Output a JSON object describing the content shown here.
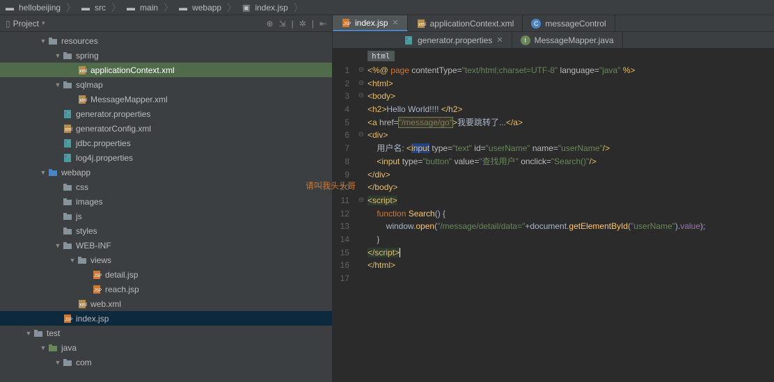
{
  "breadcrumb": [
    {
      "icon": "folder-grey",
      "label": "hellobeijing"
    },
    {
      "icon": "folder-blue",
      "label": "src"
    },
    {
      "icon": "folder-blue",
      "label": "main"
    },
    {
      "icon": "folder-blue",
      "label": "webapp"
    },
    {
      "icon": "jsp",
      "label": "index.jsp"
    }
  ],
  "sidebar": {
    "title": "Project",
    "tree": [
      {
        "indent": 56,
        "arrow": "open",
        "icon": "folder-grey",
        "label": "resources"
      },
      {
        "indent": 77,
        "arrow": "open",
        "icon": "folder-grey",
        "label": "spring"
      },
      {
        "indent": 98,
        "arrow": "none",
        "icon": "xml",
        "label": "applicationContext.xml",
        "hl": "green"
      },
      {
        "indent": 77,
        "arrow": "open",
        "icon": "folder-grey",
        "label": "sqlmap"
      },
      {
        "indent": 98,
        "arrow": "none",
        "icon": "xml",
        "label": "MessageMapper.xml"
      },
      {
        "indent": 77,
        "arrow": "none",
        "icon": "prop",
        "label": "generator.properties"
      },
      {
        "indent": 77,
        "arrow": "none",
        "icon": "xml",
        "label": "generatorConfig.xml"
      },
      {
        "indent": 77,
        "arrow": "none",
        "icon": "prop",
        "label": "jdbc.properties"
      },
      {
        "indent": 77,
        "arrow": "none",
        "icon": "prop",
        "label": "log4j.properties"
      },
      {
        "indent": 56,
        "arrow": "open",
        "icon": "folder-blue",
        "label": "webapp"
      },
      {
        "indent": 77,
        "arrow": "none",
        "icon": "folder-grey",
        "label": "css"
      },
      {
        "indent": 77,
        "arrow": "none",
        "icon": "folder-grey",
        "label": "images"
      },
      {
        "indent": 77,
        "arrow": "none",
        "icon": "folder-grey",
        "label": "js"
      },
      {
        "indent": 77,
        "arrow": "none",
        "icon": "folder-grey",
        "label": "styles"
      },
      {
        "indent": 77,
        "arrow": "open",
        "icon": "folder-grey",
        "label": "WEB-INF"
      },
      {
        "indent": 98,
        "arrow": "open",
        "icon": "folder-grey",
        "label": "views"
      },
      {
        "indent": 119,
        "arrow": "none",
        "icon": "jsp",
        "label": "detail.jsp"
      },
      {
        "indent": 119,
        "arrow": "none",
        "icon": "jsp",
        "label": "reach.jsp"
      },
      {
        "indent": 98,
        "arrow": "none",
        "icon": "xml",
        "label": "web.xml"
      },
      {
        "indent": 77,
        "arrow": "none",
        "icon": "jsp",
        "label": "index.jsp",
        "selected": true
      },
      {
        "indent": 35,
        "arrow": "open",
        "icon": "folder-grey",
        "label": "test"
      },
      {
        "indent": 56,
        "arrow": "open",
        "icon": "folder-green",
        "label": "java"
      },
      {
        "indent": 77,
        "arrow": "open",
        "icon": "folder-grey",
        "label": "com"
      }
    ]
  },
  "editor": {
    "tabs_row1": [
      {
        "icon": "jsp",
        "label": "index.jsp",
        "active": true,
        "closable": true
      },
      {
        "icon": "xml",
        "label": "applicationContext.xml",
        "active": false
      },
      {
        "icon": "class",
        "label": "messageControl",
        "active": false,
        "circle": "C"
      }
    ],
    "tabs_row2": [
      {
        "icon": "prop",
        "label": "generator.properties",
        "active": false,
        "closable": true
      },
      {
        "icon": "class",
        "label": "MessageMapper.java",
        "active": false,
        "circle": "I"
      }
    ],
    "nav_tag": "html",
    "lines": [
      "1",
      "2",
      "3",
      "4",
      "5",
      "6",
      "7",
      "8",
      "9",
      "10",
      "11",
      "12",
      "13",
      "14",
      "15",
      "16",
      "17"
    ],
    "fold": [
      "⊖",
      "⊖",
      "⊖",
      "",
      "",
      "⊖",
      "",
      "",
      "",
      "",
      "⊖",
      "",
      "",
      "",
      "",
      "",
      ""
    ],
    "code": {
      "l1": {
        "pre": "<%@ ",
        "kw": "page",
        "a1": " contentType=",
        "v1": "\"text/html;charset=UTF-8\"",
        "a2": " language=",
        "v2": "\"java\"",
        "suf": " %>"
      },
      "l2": "<html>",
      "l3": "<body>",
      "l4": {
        "open": "<h2>",
        "txt": "Hello World!!!! ",
        "close": "</h2>"
      },
      "l5": {
        "o": "<a ",
        "a": "href=",
        "v": "\"/message/go\"",
        "c": ">",
        "txt": "我要跳转了...",
        "cl": "</a>"
      },
      "l6": "<div>",
      "l7": {
        "txt": "    用户名: <",
        "tag": "input",
        "attrs": " type=",
        "v1": "\"text\"",
        "a2": " id=",
        "v2": "\"userName\"",
        "a3": " name=",
        "v3": "\"userName\"",
        "end": "/>"
      },
      "l8": {
        "pre": "    <",
        "tag": "input",
        "a1": " type=",
        "v1": "\"button\"",
        "a2": " value=",
        "v2": "\"查找用户\"",
        "a3": " onclick=",
        "v3": "\"Search()\"",
        "end": "/>"
      },
      "l9": "</div>",
      "l10": "</body>",
      "l11": "<script>",
      "l12": {
        "kw": "    function ",
        "fn": "Search",
        "p": "() {"
      },
      "l13": {
        "pre": "        window.",
        "m": "open",
        "p1": "(",
        "s1": "\"/message/detail/data=\"",
        "plus": "+document.",
        "m2": "getElementById",
        "p2": "(",
        "s2": "\"userName\"",
        "p3": ").",
        "prop": "value",
        "end": ");"
      },
      "l14": "    }",
      "l15": "</script>",
      "l16": "</html>"
    }
  },
  "caption": "请叫我头头哥"
}
